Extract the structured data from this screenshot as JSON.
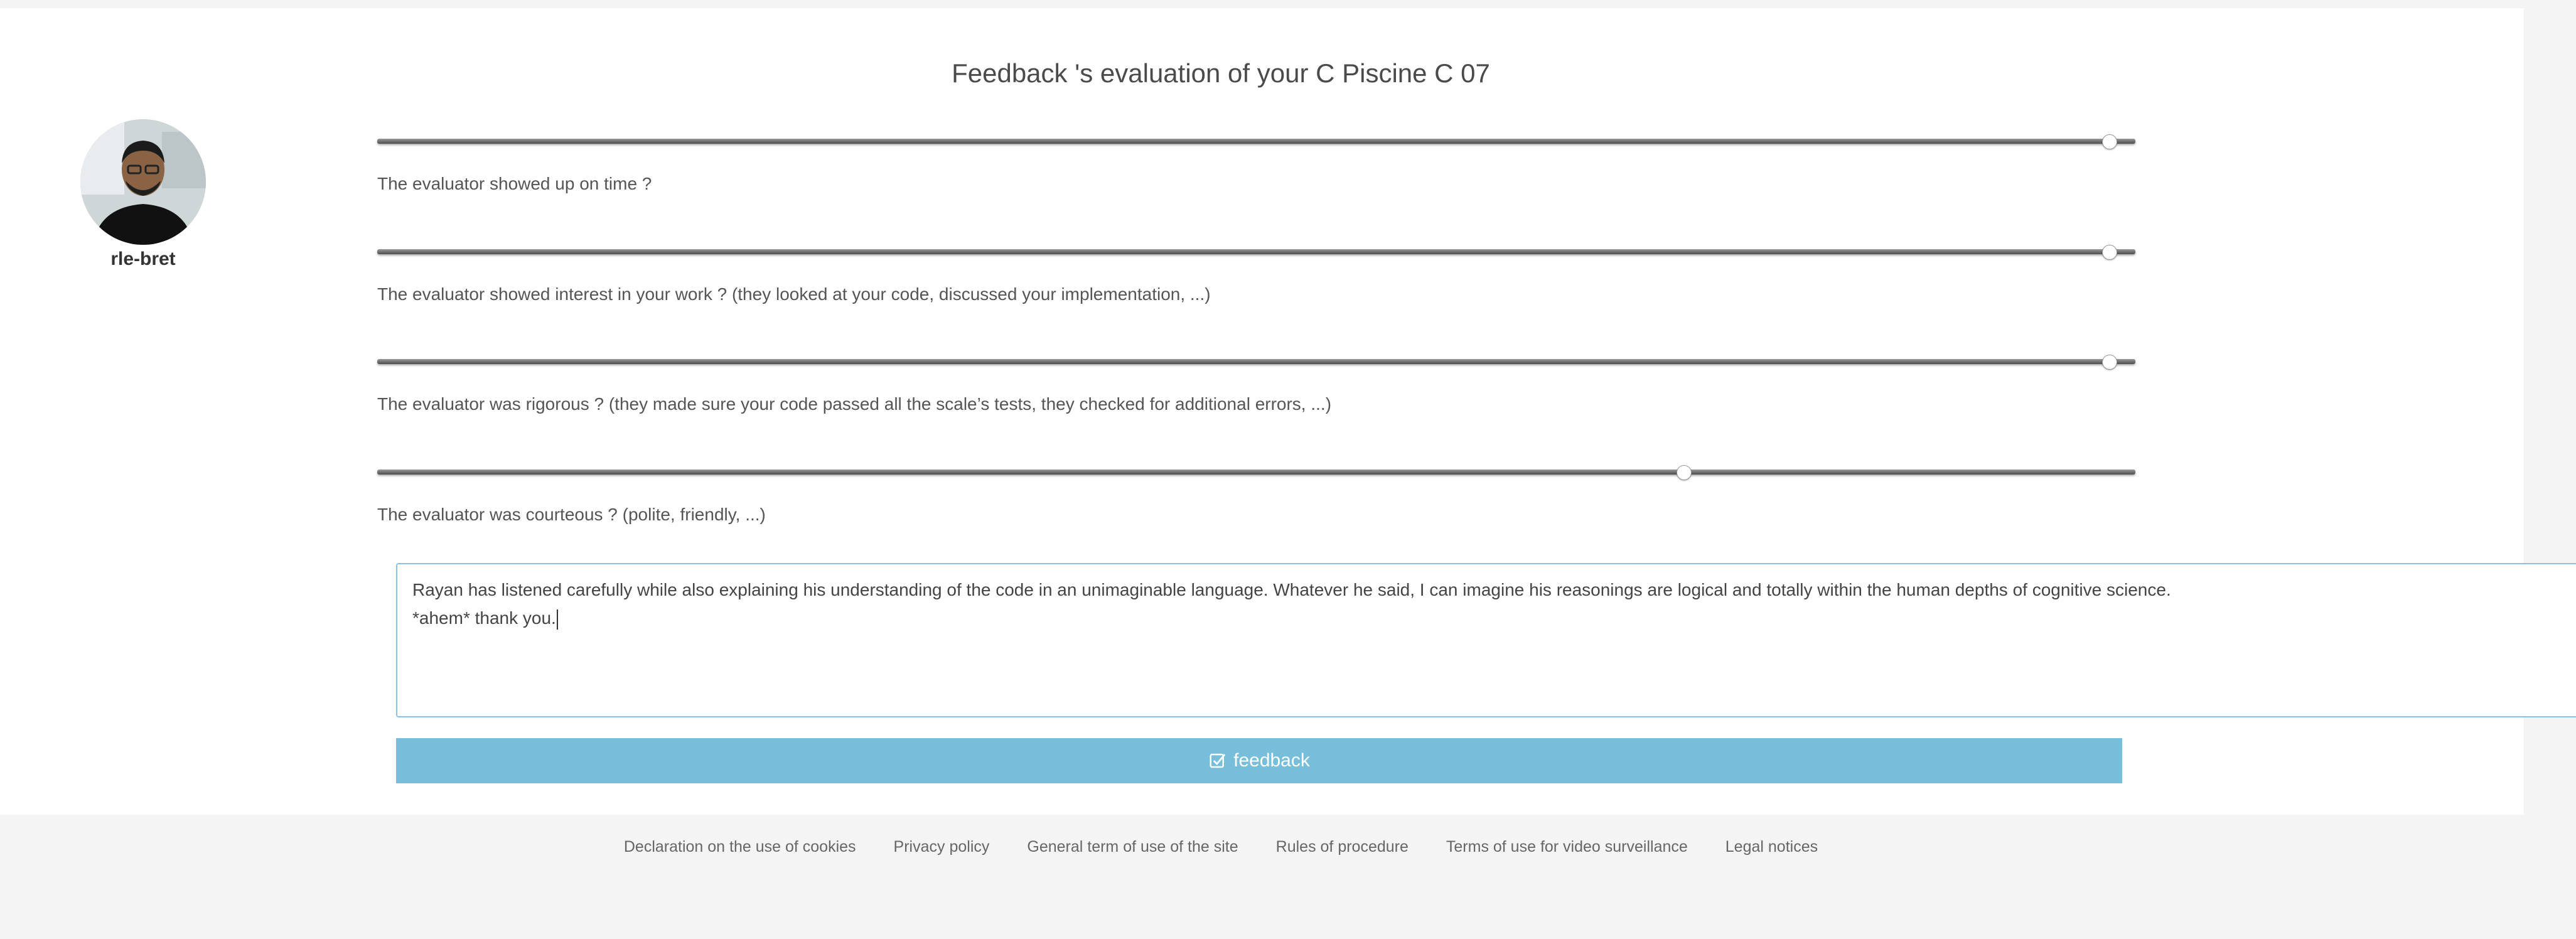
{
  "page": {
    "title": "Feedback 's evaluation of your C Piscine C 07"
  },
  "user": {
    "login": "rle-bret"
  },
  "questions": [
    {
      "label": "The evaluator showed up on time ?",
      "value_percent": 98.5
    },
    {
      "label": "The evaluator showed interest in your work ? (they looked at your code, discussed your implementation, ...)",
      "value_percent": 98.5
    },
    {
      "label": "The evaluator was rigorous ? (they made sure your code passed all the scale’s tests, they checked for additional errors, ...)",
      "value_percent": 98.5
    },
    {
      "label": "The evaluator was courteous ? (polite, friendly, ...)",
      "value_percent": 74.3
    }
  ],
  "comment": {
    "value": "Rayan has listened carefully while also explaining his understanding of the code in an unimaginable language. Whatever he said, I can imagine his reasonings are logical and totally within the human depths of cognitive science.\n*ahem* thank you."
  },
  "submit": {
    "label": "feedback",
    "color": "#77bedb"
  },
  "footer": {
    "links": [
      "Declaration on the use of cookies",
      "Privacy policy",
      "General term of use of the site",
      "Rules of procedure",
      "Terms of use for video surveillance",
      "Legal notices"
    ]
  }
}
